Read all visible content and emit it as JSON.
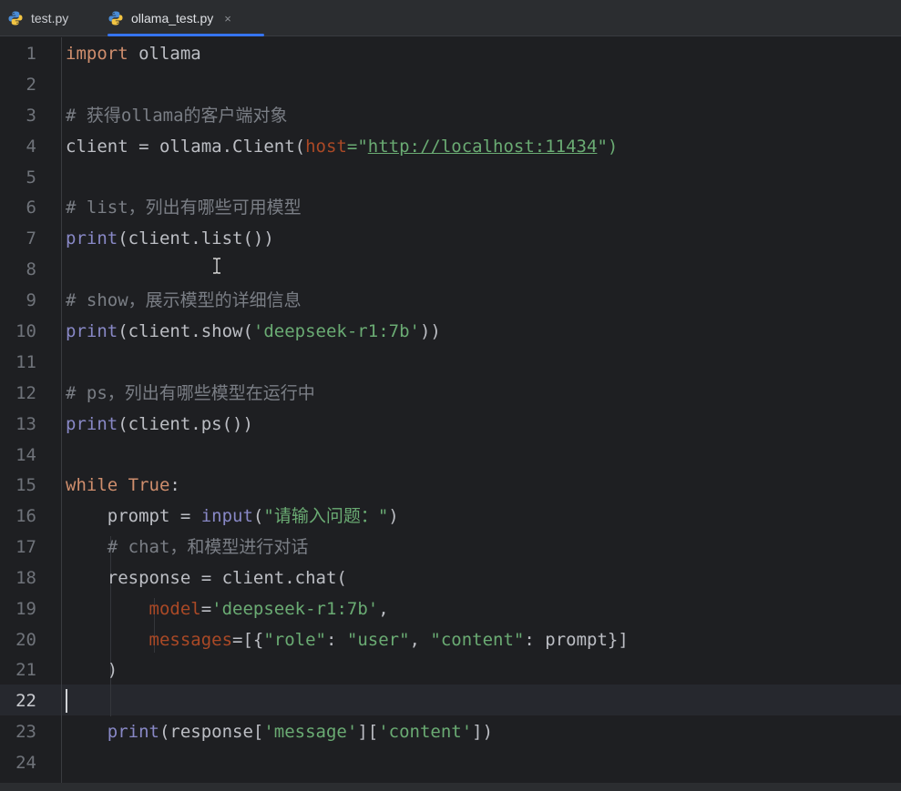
{
  "tabs": [
    {
      "label": "test.py",
      "icon": "python-icon",
      "active": false
    },
    {
      "label": "ollama_test.py",
      "icon": "python-icon",
      "active": true,
      "close": "×"
    }
  ],
  "editor": {
    "current_line": 22,
    "lines": [
      {
        "n": "1"
      },
      {
        "n": "2"
      },
      {
        "n": "3"
      },
      {
        "n": "4"
      },
      {
        "n": "5"
      },
      {
        "n": "6"
      },
      {
        "n": "7"
      },
      {
        "n": "8"
      },
      {
        "n": "9"
      },
      {
        "n": "10"
      },
      {
        "n": "11"
      },
      {
        "n": "12"
      },
      {
        "n": "13"
      },
      {
        "n": "14"
      },
      {
        "n": "15"
      },
      {
        "n": "16"
      },
      {
        "n": "17"
      },
      {
        "n": "18"
      },
      {
        "n": "19"
      },
      {
        "n": "20"
      },
      {
        "n": "21"
      },
      {
        "n": "22"
      },
      {
        "n": "23"
      },
      {
        "n": "24"
      }
    ],
    "tokens": {
      "l1_kw": "import",
      "l1_rest": " ollama",
      "l3": "# 获得ollama的客户端对象",
      "l4_a": "client = ollama.Client(",
      "l4_param": "host",
      "l4_eq": "=\"",
      "l4_url": "http://localhost:11434",
      "l4_end": "\")",
      "l6": "# list，列出有哪些可用模型",
      "l7_bi": "print",
      "l7_rest": "(client.list())",
      "l9": "# show，展示模型的详细信息",
      "l10_bi": "print",
      "l10_a": "(client.show(",
      "l10_str": "'deepseek-r1:7b'",
      "l10_end": "))",
      "l12": "# ps，列出有哪些模型在运行中",
      "l13_bi": "print",
      "l13_rest": "(client.ps())",
      "l15_kw": "while",
      "l15_sp": " ",
      "l15_true": "True",
      "l15_colon": ":",
      "l16_a": "    prompt = ",
      "l16_bi": "input",
      "l16_paren": "(",
      "l16_str": "\"请输入问题：\"",
      "l16_end": ")",
      "l17": "    # chat，和模型进行对话",
      "l18": "    response = client.chat(",
      "l19_ind": "        ",
      "l19_param": "model",
      "l19_eq": "=",
      "l19_str": "'deepseek-r1:7b'",
      "l19_end": ",",
      "l20_ind": "        ",
      "l20_param": "messages",
      "l20_a": "=[{",
      "l20_s1": "\"role\"",
      "l20_c1": ": ",
      "l20_s2": "\"user\"",
      "l20_c2": ", ",
      "l20_s3": "\"content\"",
      "l20_end": ": prompt}]",
      "l21": "    )",
      "l23_ind": "    ",
      "l23_bi": "print",
      "l23_a": "(response[",
      "l23_s1": "'message'",
      "l23_b": "][",
      "l23_s2": "'content'",
      "l23_end": "])"
    }
  },
  "colors": {
    "background": "#1e1f22",
    "keyword": "#cf8e6d",
    "comment": "#7a7e85",
    "string": "#6aab73",
    "builtin": "#8888c6",
    "parameter": "#aa4926",
    "tab_underline": "#3574f0"
  }
}
